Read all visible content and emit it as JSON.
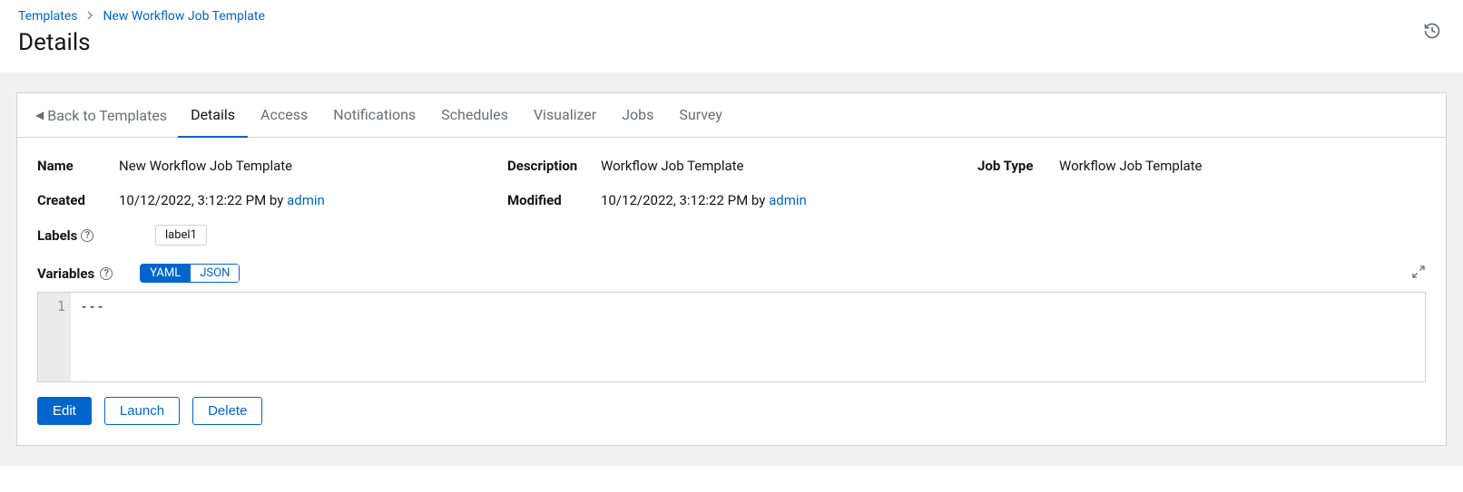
{
  "breadcrumb": {
    "root": "Templates",
    "current": "New Workflow Job Template"
  },
  "page_title": "Details",
  "back_link": "Back to Templates",
  "tabs": {
    "details": "Details",
    "access": "Access",
    "notifications": "Notifications",
    "schedules": "Schedules",
    "visualizer": "Visualizer",
    "jobs": "Jobs",
    "survey": "Survey"
  },
  "fields": {
    "name_label": "Name",
    "name_value": "New Workflow Job Template",
    "description_label": "Description",
    "description_value": "Workflow Job Template",
    "job_type_label": "Job Type",
    "job_type_value": "Workflow Job Template",
    "created_label": "Created",
    "created_date": "10/12/2022, 3:12:22 PM by ",
    "created_user": "admin",
    "modified_label": "Modified",
    "modified_date": "10/12/2022, 3:12:22 PM by ",
    "modified_user": "admin",
    "labels_label": "Labels",
    "labels_chip": "label1",
    "variables_label": "Variables"
  },
  "toggle": {
    "yaml": "YAML",
    "json": "JSON"
  },
  "code": {
    "line_number": "1",
    "content": "---"
  },
  "buttons": {
    "edit": "Edit",
    "launch": "Launch",
    "delete": "Delete"
  }
}
